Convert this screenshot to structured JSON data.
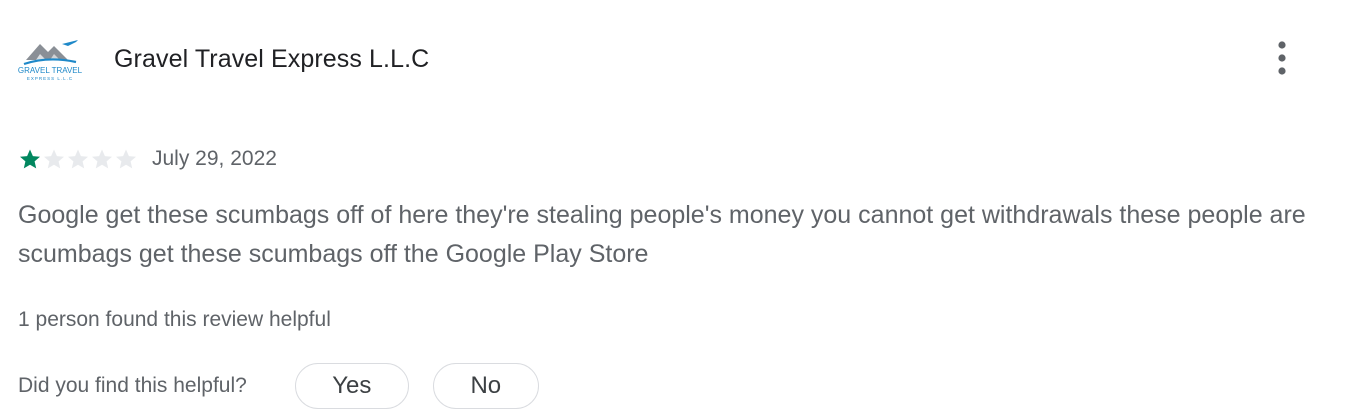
{
  "reviewer": {
    "name": "Gravel Travel Express L.L.C",
    "avatar_icon": "gravel-travel-logo",
    "avatar_text": "GRAVEL TRAVEL",
    "avatar_subtext": "EXPRESS L.L.C"
  },
  "menu": {
    "icon": "more-vert-icon"
  },
  "rating": {
    "value": 1,
    "max": 5,
    "filled_color": "#01875f",
    "empty_color": "#e8eaed"
  },
  "review": {
    "date": "July 29, 2022",
    "text": "Google get these scumbags off of here they're stealing people's money you cannot get withdrawals these people are scumbags get these scumbags off the Google Play Store",
    "helpful_count_text": "1 person found this review helpful"
  },
  "feedback": {
    "question": "Did you find this helpful?",
    "yes_label": "Yes",
    "no_label": "No"
  }
}
